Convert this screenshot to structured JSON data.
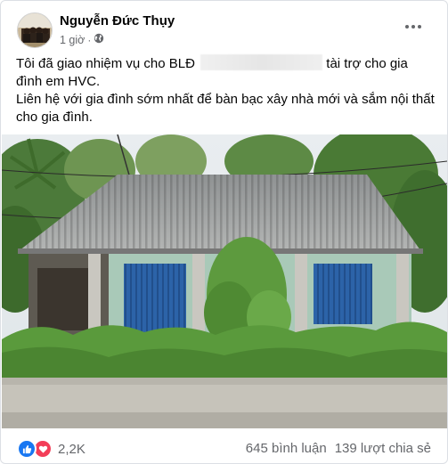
{
  "post": {
    "author": "Nguyễn Đức Thụy",
    "time": "1 giờ",
    "privacy_icon": "globe-icon",
    "menu_icon": "more-options-icon",
    "text_line1_before": "Tôi đã giao nhiệm vụ cho BLĐ",
    "text_line1_after": "tài trợ cho gia đình em HVC.",
    "text_line2": "Liên hệ với gia đình sớm nhất để bàn bạc xây nhà mới và sắm nội thất cho gia đình."
  },
  "engagement": {
    "reaction_icons": [
      "like-icon",
      "love-icon"
    ],
    "reaction_count": "2,2K",
    "comments": "645 bình luận",
    "shares": "139 lượt chia sẻ"
  },
  "colors": {
    "like": "#1877f2",
    "love": "#f33e58",
    "secondary_text": "#65676b"
  }
}
